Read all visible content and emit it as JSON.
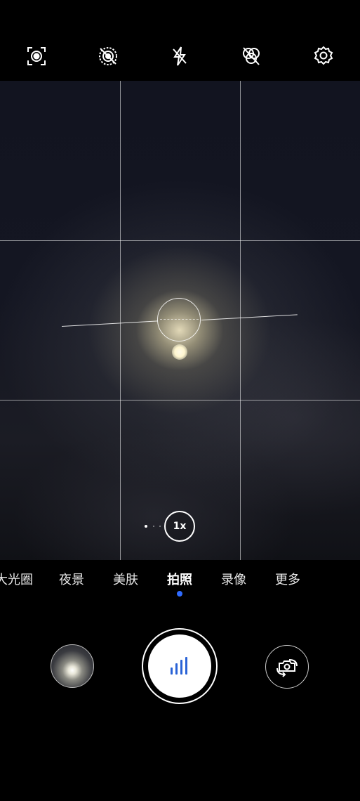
{
  "top_bar": {
    "icons": [
      {
        "name": "ai-scene-icon"
      },
      {
        "name": "live-photo-off-icon"
      },
      {
        "name": "flash-off-icon"
      },
      {
        "name": "filter-off-icon"
      },
      {
        "name": "settings-icon"
      }
    ]
  },
  "viewfinder": {
    "zoom_label": "1x",
    "grid": "3x3"
  },
  "modes": {
    "items": [
      "大光圈",
      "夜景",
      "美肤",
      "拍照",
      "录像",
      "更多"
    ],
    "active": "拍照",
    "indicator_color": "#2f6bff"
  },
  "controls": {
    "shutter_icon": "bars-icon",
    "shutter_icon_color": "#2a63d6",
    "flip_icon": "camera-flip-icon"
  }
}
